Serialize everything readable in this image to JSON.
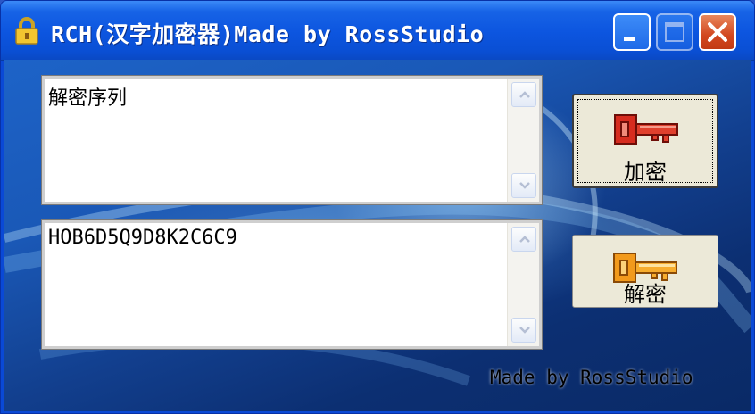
{
  "window": {
    "title": "RCH(汉字加密器)Made by RossStudio",
    "icon": "lock-icon"
  },
  "input_area": {
    "value": "解密序列"
  },
  "output_area": {
    "value": "HOB6D5Q9D8K2C6C9"
  },
  "buttons": {
    "encrypt_label": "加密",
    "decrypt_label": "解密"
  },
  "footer": {
    "text": "Made by RossStudio"
  },
  "colors": {
    "titlebar": "#0c55df",
    "close": "#d2471f",
    "encrypt_key": "#d62c1f",
    "decrypt_key": "#f29a1c"
  }
}
